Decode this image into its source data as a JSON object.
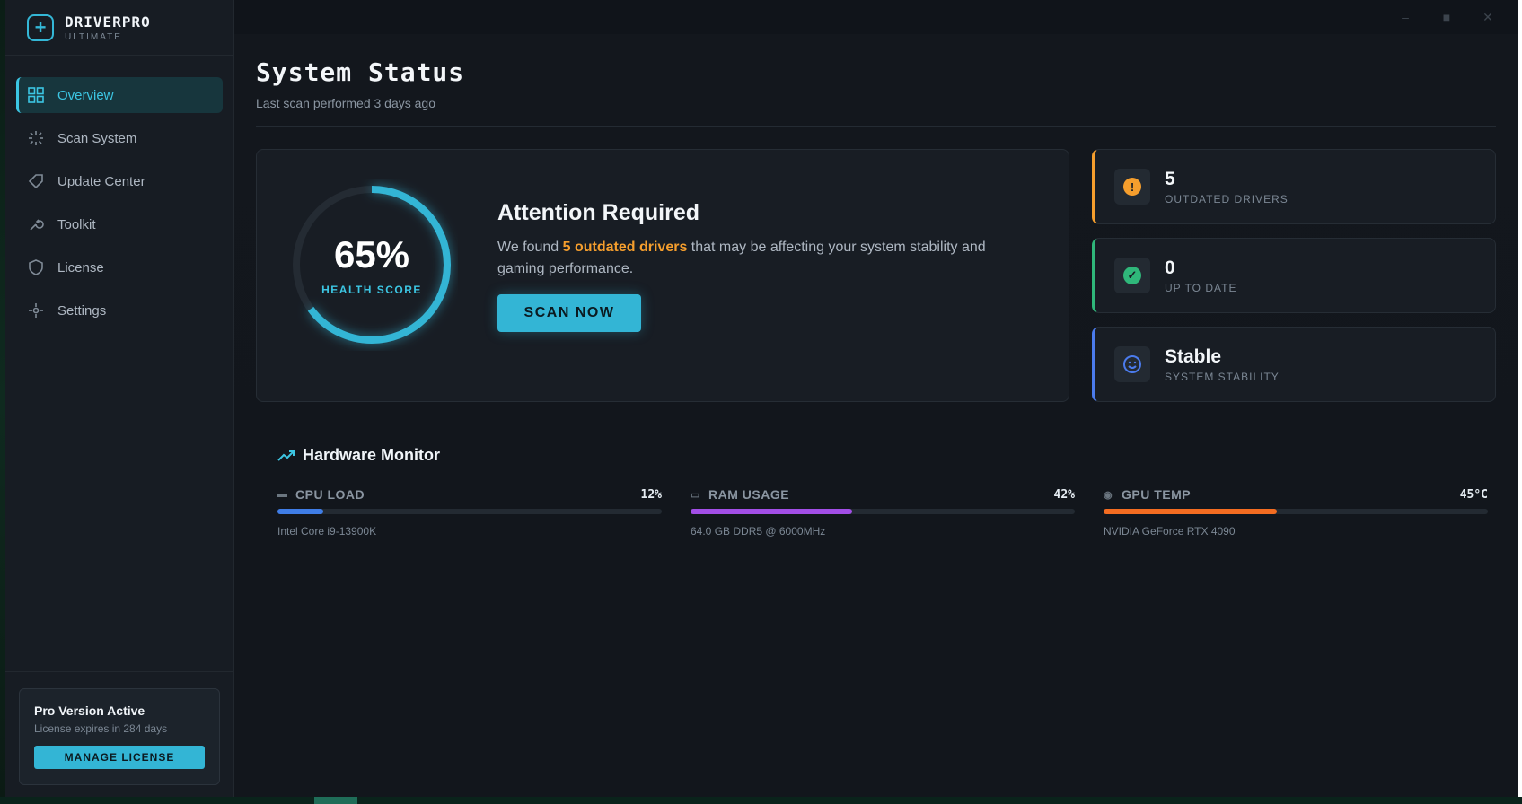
{
  "brand": {
    "name": "DRIVERPRO",
    "edition": "ULTIMATE"
  },
  "nav": [
    {
      "label": "Overview",
      "icon": "grid-icon",
      "active": true
    },
    {
      "label": "Scan System",
      "icon": "scan-icon"
    },
    {
      "label": "Update Center",
      "icon": "tag-icon"
    },
    {
      "label": "Toolkit",
      "icon": "wrench-icon"
    },
    {
      "label": "License",
      "icon": "shield-icon"
    },
    {
      "label": "Settings",
      "icon": "settings-icon"
    }
  ],
  "license": {
    "title": "Pro Version Active",
    "expiry": "License expires in 284 days",
    "button": "MANAGE LICENSE"
  },
  "page": {
    "title": "System Status",
    "subtitle": "Last scan performed 3 days ago"
  },
  "health": {
    "score_text": "65%",
    "score": 0.65,
    "label": "HEALTH SCORE",
    "attention_title": "Attention Required",
    "message_pre": "We found ",
    "message_highlight": "5 outdated drivers",
    "message_post": " that may be affecting your system stability and gaming performance.",
    "scan_button": "SCAN NOW"
  },
  "stats": [
    {
      "value": "5",
      "label": "OUTDATED DRIVERS",
      "color": "#f59e2d",
      "icon": "warning-icon"
    },
    {
      "value": "0",
      "label": "UP TO DATE",
      "color": "#2fb77a",
      "icon": "check-icon"
    },
    {
      "value": "Stable",
      "label": "SYSTEM STABILITY",
      "color": "#4b7bec",
      "icon": "smile-icon"
    }
  ],
  "hardware": {
    "title": "Hardware Monitor",
    "items": [
      {
        "name": "CPU LOAD",
        "value_text": "12%",
        "level": 0.12,
        "detail": "Intel Core i9-13900K",
        "color": "#3f7de6"
      },
      {
        "name": "RAM USAGE",
        "value_text": "42%",
        "level": 0.42,
        "detail": "64.0 GB DDR5 @ 6000MHz",
        "color": "#a24ee6"
      },
      {
        "name": "GPU TEMP",
        "value_text": "45°C",
        "level": 0.45,
        "detail": "NVIDIA GeForce RTX 4090",
        "color": "#f36c21"
      }
    ]
  }
}
